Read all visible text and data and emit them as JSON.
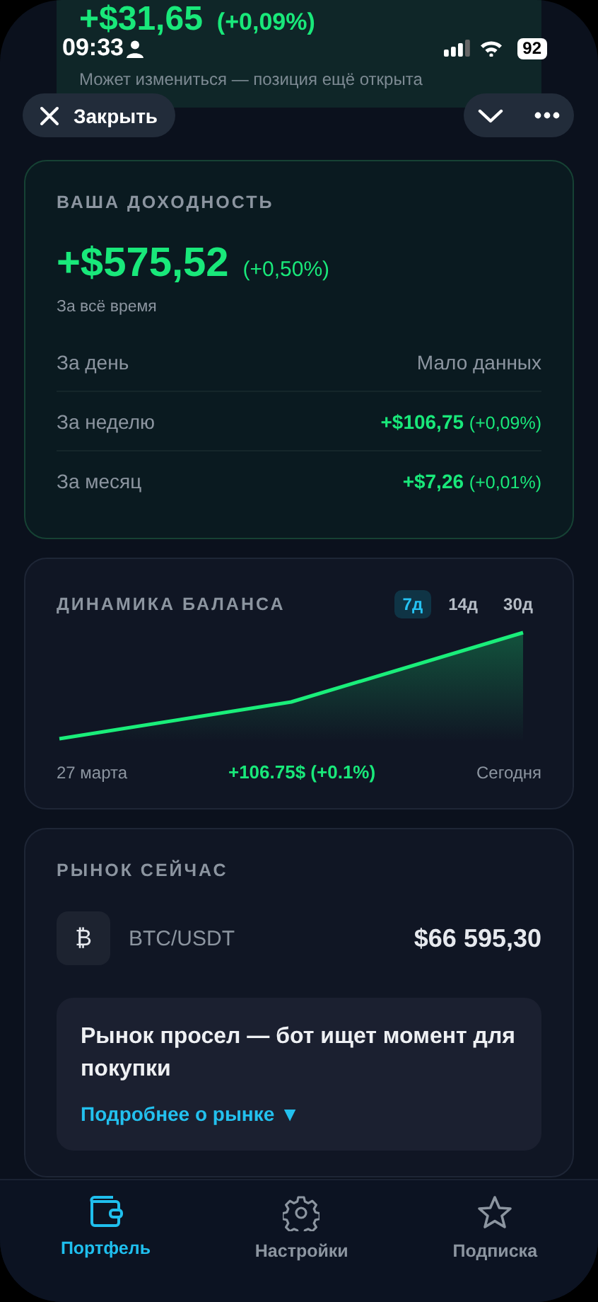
{
  "status_bar": {
    "time": "09:33",
    "battery": "92"
  },
  "position_header": {
    "amount": "+$31,65",
    "change": "(+0,09%)",
    "note": "Может измениться — позиция ещё открыта"
  },
  "toolbar": {
    "close": "Закрыть"
  },
  "returns": {
    "title": "ВАША ДОХОДНОСТЬ",
    "amount": "+$575,52",
    "change": "(+0,50%)",
    "caption": "За всё время",
    "rows": [
      {
        "label": "За день",
        "kind": "muted",
        "value": "Мало данных"
      },
      {
        "label": "За неделю",
        "kind": "gain",
        "value": "+$106,75",
        "change": "(+0,09%)"
      },
      {
        "label": "За месяц",
        "kind": "gain",
        "value": "+$7,26",
        "change": "(+0,01%)"
      }
    ]
  },
  "balance": {
    "title": "ДИНАМИКА БАЛАНСА",
    "ranges": [
      {
        "label": "7д",
        "selected": true
      },
      {
        "label": "14д",
        "selected": false
      },
      {
        "label": "30д",
        "selected": false
      }
    ],
    "start_label": "27 марта",
    "summary": "+106.75$ (+0.1%)",
    "end_label": "Сегодня"
  },
  "market": {
    "title": "РЫНОК СЕЙЧАС",
    "symbol": "₿",
    "pair": "BTC/USDT",
    "price": "$66 595,30",
    "message": "Рынок просел — бот ищет момент для покупки",
    "link": "Подробнее о рынке",
    "link_caret": "▼"
  },
  "tabs": [
    {
      "label": "Портфель",
      "kind": "wallet",
      "selected": true
    },
    {
      "label": "Настройки",
      "kind": "gear",
      "selected": false
    },
    {
      "label": "Подписка",
      "kind": "star",
      "selected": false
    }
  ]
}
